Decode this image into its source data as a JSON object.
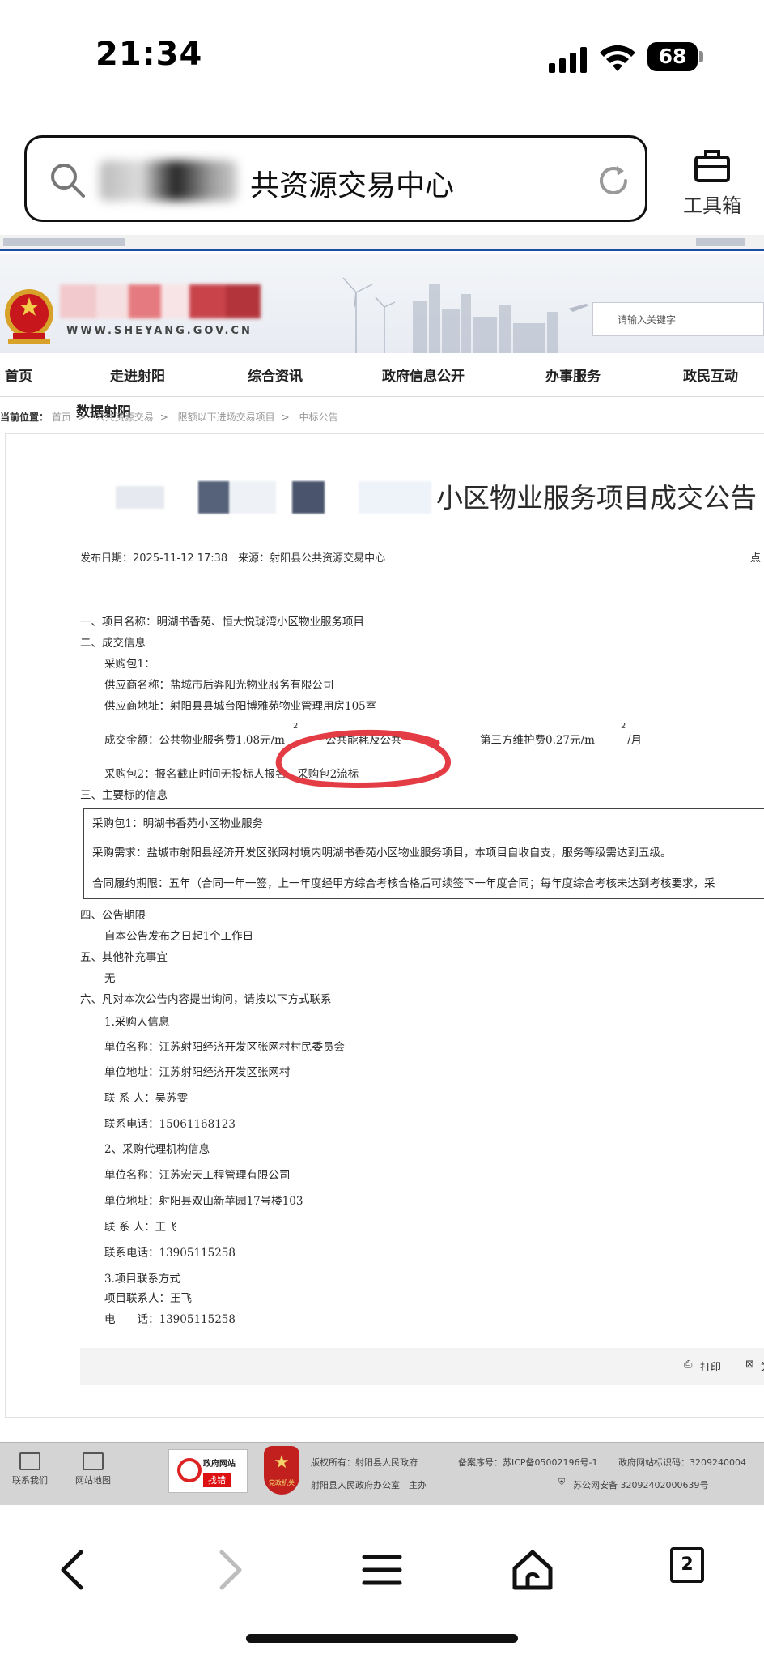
{
  "status": {
    "time": "21:34",
    "battery": "68"
  },
  "address_bar": {
    "text": "共资源交易中心"
  },
  "toolbox": {
    "label": "工具箱"
  },
  "site": {
    "domain": "WWW.SHEYANG.GOV.CN",
    "search_placeholder": "请输入关键字",
    "nav": [
      "首页",
      "走进射阳",
      "综合资讯",
      "政府信息公开",
      "办事服务",
      "政民互动"
    ],
    "nav_sub": "数据射阳",
    "breadcrumb": {
      "label": "当前位置：",
      "items": [
        "首页",
        "公共资源交易",
        "限额以下进场交易项目",
        "中标公告"
      ]
    }
  },
  "article": {
    "title": "小区物业服务项目成交公告",
    "meta": "发布日期：2025-11-12 17:38　来源：射阳县公共资源交易中心",
    "meta_right": "点",
    "lines": [
      "一、项目名称：明湖书香苑、恒大悦珑湾小区物业服务项目",
      "二、成交信息",
      "采购包1：",
      "供应商名称：盐城市后羿阳光物业服务有限公司",
      "供应商地址：射阳县县城台阳博雅苑物业管理用房105室",
      "成交金额：公共物业服务费1.08元/m",
      "公共能耗及公共",
      "第三方维护费0.27元/m",
      "/月",
      "采购包2：报名截止时间无投标人报名，采购包2流标",
      "三、主要标的信息",
      "采购包1：明湖书香苑小区物业服务",
      "采购需求：盐城市射阳县经济开发区张网村境内明湖书香苑小区物业服务项目，本项目自收自支，服务等级需达到五级。",
      "合同履约期限：五年（合同一年一签，上一年度经甲方综合考核合格后可续签下一年度合同；每年度综合考核未达到考核要求，采",
      "四、公告期限",
      "自本公告发布之日起1个工作日",
      "五、其他补充事宜",
      "无",
      "六、凡对本次公告内容提出询问，请按以下方式联系",
      "1.采购人信息",
      "单位名称：江苏射阳经济开发区张网村村民委员会",
      "单位地址：江苏射阳经济开发区张网村",
      "联 系 人：吴苏雯",
      "联系电话：15061168123",
      "2、采购代理机构信息",
      "单位名称：江苏宏天工程管理有限公司",
      "单位地址：射阳县双山新苹园17号楼103",
      "联 系 人：王飞",
      "联系电话：13905115258",
      "3.项目联系方式",
      "项目联系人：王飞",
      "电　　话：13905115258"
    ],
    "sup": "2",
    "print_label": "打印",
    "close_label": "关"
  },
  "footer": {
    "links": [
      "联系我们",
      "网站地图"
    ],
    "jiucuo_title": "政府网站",
    "jiucuo_badge": "找错",
    "dangzheng_label": "党政机关",
    "owner": "版权所有：射阳县人民政府",
    "organizer": "射阳县人民政府办公室　主办",
    "icp": "备案序号：苏ICP备05002196号-1",
    "site_code": "政府网站标识码：3209240004",
    "police": "苏公网安备 32092402000639号"
  },
  "toolbar": {
    "tab_count": "2"
  }
}
